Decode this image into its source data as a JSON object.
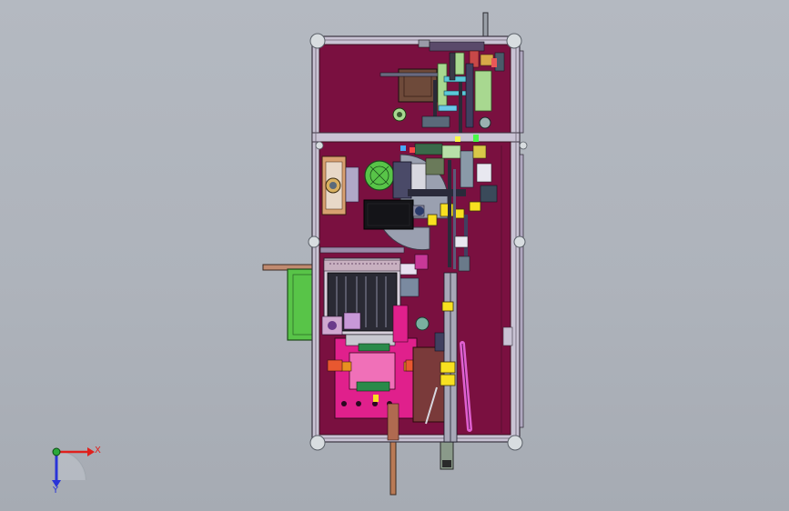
{
  "view": {
    "background_top": "#b4b9c1",
    "background_bottom": "#a6abb3"
  },
  "machine": {
    "panel_color": "#7a1040",
    "frame_color": "#c9c3d4",
    "frame_edge": "#3a3340",
    "foot_color": "#d8dde0"
  },
  "axes": {
    "x_label": "X",
    "y_label": "Y",
    "x_color": "#e0201c",
    "y_color": "#2a34d8",
    "origin_color": "#2aa83a"
  }
}
